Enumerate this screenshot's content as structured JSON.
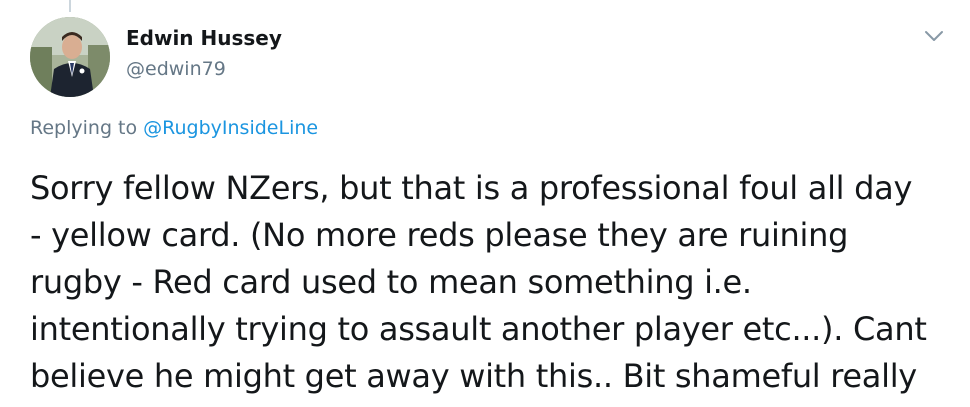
{
  "tweet": {
    "author": {
      "name": "Edwin Hussey",
      "handle": "@edwin79"
    },
    "reply_context": {
      "prefix": "Replying to ",
      "mention": "@RugbyInsideLine"
    },
    "text_lines": [
      "Sorry fellow NZers, but that is a professional foul all day",
      "- yellow card. (No more reds please they are ruining",
      "rugby - Red card used to mean something i.e.",
      "intentionally trying to assault another player etc...). Cant",
      "believe he might get away with this.. Bit shameful really"
    ]
  },
  "colors": {
    "text_primary": "#14171a",
    "text_secondary": "#657786",
    "link": "#1b95e0",
    "thread_line": "#ccd6dd"
  },
  "icons": {
    "more_menu": "chevron-down-icon"
  }
}
